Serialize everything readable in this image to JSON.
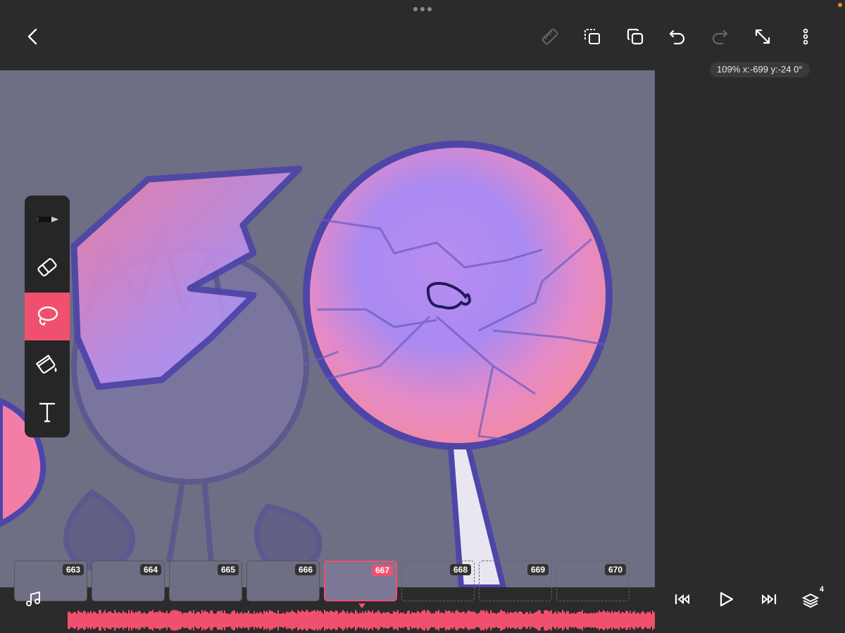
{
  "app": {
    "zoom_readout": "109% x:-699 y:-24 0°",
    "accent_color": "#f0506e",
    "canvas_color": "#6e6e85"
  },
  "topbar": {
    "buttons": [
      {
        "name": "back-button",
        "icon": "chevron-left-icon"
      },
      {
        "name": "ruler-button",
        "icon": "ruler-icon",
        "enabled": false
      },
      {
        "name": "duplicate-button",
        "icon": "duplicate-icon"
      },
      {
        "name": "copy-layer-button",
        "icon": "copy-icon"
      },
      {
        "name": "undo-button",
        "icon": "undo-icon"
      },
      {
        "name": "redo-button",
        "icon": "redo-icon",
        "enabled": false
      },
      {
        "name": "fullscreen-button",
        "icon": "expand-icon"
      },
      {
        "name": "more-button",
        "icon": "more-vertical-icon"
      }
    ]
  },
  "tools": [
    {
      "name": "brush",
      "icon": "pen-icon",
      "active": false
    },
    {
      "name": "eraser",
      "icon": "eraser-icon",
      "active": false
    },
    {
      "name": "lasso",
      "icon": "lasso-icon",
      "active": true
    },
    {
      "name": "fill",
      "icon": "paint-bucket-icon",
      "active": false
    },
    {
      "name": "text",
      "icon": "text-icon",
      "active": false
    }
  ],
  "timeline": {
    "frames": [
      {
        "num": "663",
        "state": "filled-partial"
      },
      {
        "num": "664",
        "state": "filled"
      },
      {
        "num": "665",
        "state": "filled"
      },
      {
        "num": "666",
        "state": "filled"
      },
      {
        "num": "667",
        "state": "current"
      },
      {
        "num": "668",
        "state": "empty"
      },
      {
        "num": "669",
        "state": "empty"
      },
      {
        "num": "670",
        "state": "empty"
      }
    ]
  },
  "playback": {
    "layer_count": "4"
  }
}
